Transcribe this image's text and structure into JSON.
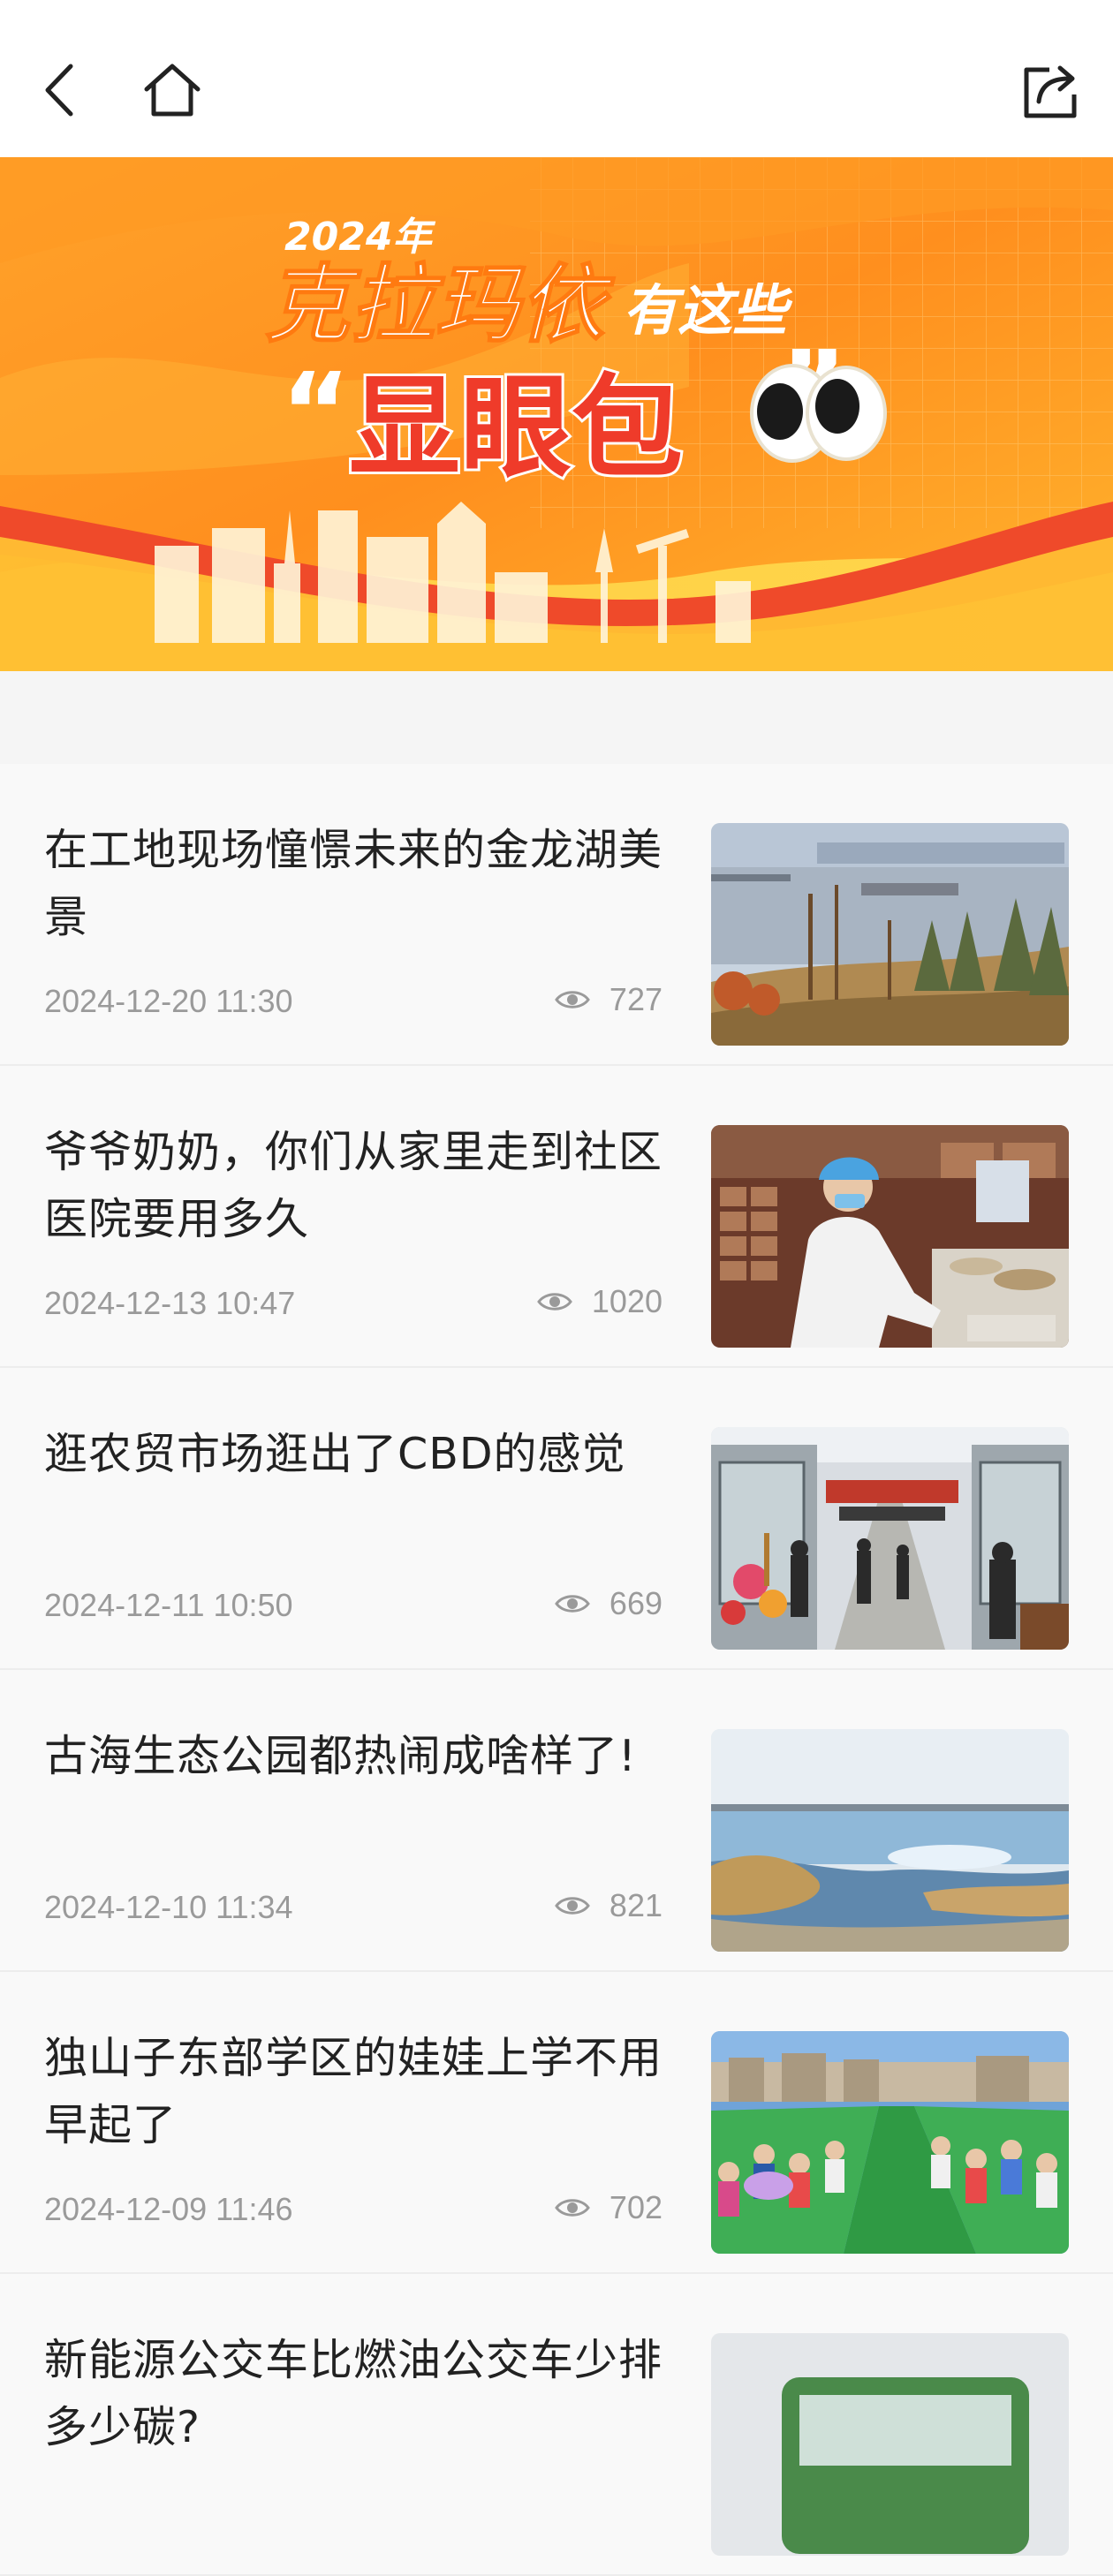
{
  "nav": {
    "back_icon": "chevron-left-icon",
    "home_icon": "home-icon",
    "share_icon": "share-icon"
  },
  "banner": {
    "year": "2024年",
    "line1_main": "克拉玛依",
    "line1_suffix": "有这些",
    "open_quote": "“",
    "highlight": "显眼包",
    "close_quote": "”",
    "colors": {
      "orange": "#ff8a1f",
      "yellow": "#ffc23a",
      "red": "#ef4a2a"
    }
  },
  "news": [
    {
      "title": "在工地现场憧憬未来的金龙湖美景",
      "date": "2024-12-20 11:30",
      "views": "727",
      "thumb": "lake-landscape"
    },
    {
      "title": "爷爷奶奶，你们从家里走到社区医院要用多久",
      "date": "2024-12-13 10:47",
      "views": "1020",
      "thumb": "pharmacy"
    },
    {
      "title": "逛农贸市场逛出了CBD的感觉",
      "date": "2024-12-11 10:50",
      "views": "669",
      "thumb": "market"
    },
    {
      "title": "古海生态公园都热闹成啥样了!",
      "date": "2024-12-10 11:34",
      "views": "821",
      "thumb": "wetland"
    },
    {
      "title": "独山子东部学区的娃娃上学不用早起了",
      "date": "2024-12-09 11:46",
      "views": "702",
      "thumb": "school-children"
    },
    {
      "title": "新能源公交车比燃油公交车少排多少碳?",
      "date": "",
      "views": "",
      "thumb": "bus"
    }
  ]
}
